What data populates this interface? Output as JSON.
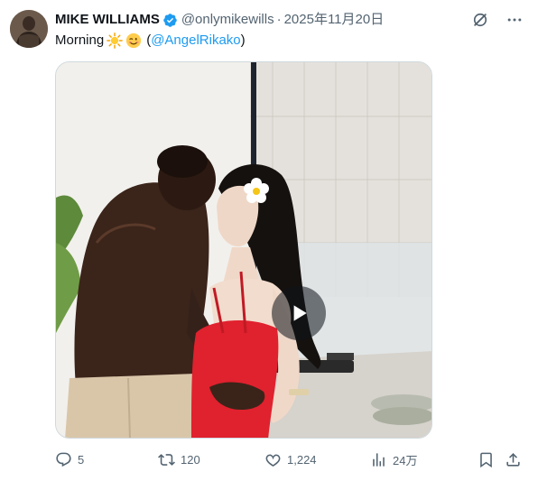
{
  "author": {
    "name": "MIKE WILLIAMS",
    "handle": "@onlymikewills",
    "separator": "·",
    "date": "2025年11月20日"
  },
  "tweet": {
    "text_prefix": "Morning",
    "emojis": [
      "sun-emoji",
      "winking-face-emoji"
    ],
    "paren_open": "(",
    "mention": "@AngelRikako",
    "paren_close": ")"
  },
  "media": {
    "type": "video",
    "play_icon": "play-icon"
  },
  "actions": {
    "replies": "5",
    "reposts": "120",
    "likes": "1,224",
    "views": "24万"
  },
  "icons": {
    "top_right": [
      "grok-icon",
      "more-icon"
    ],
    "actions": [
      "reply-icon",
      "repost-icon",
      "like-icon",
      "views-icon",
      "bookmark-icon",
      "share-icon"
    ]
  },
  "colors": {
    "accent": "#1d9bf0",
    "secondary_text": "#536471",
    "verified": "#1d9bf0"
  }
}
